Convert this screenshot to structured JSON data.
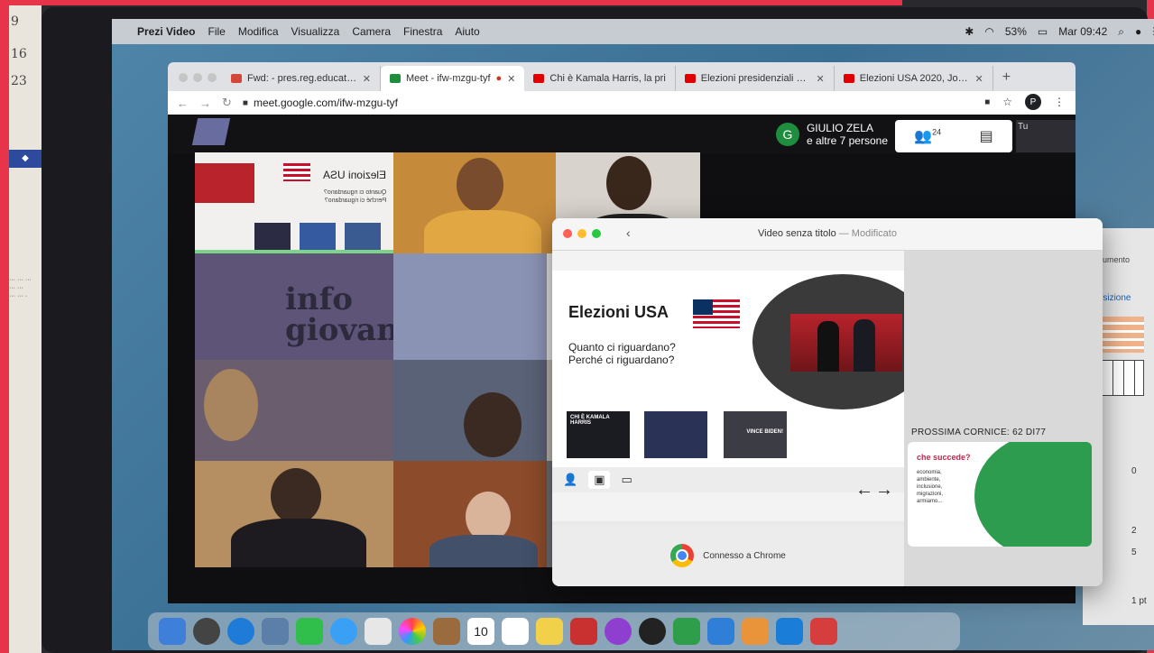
{
  "menubar": {
    "app_name": "Prezi Video",
    "items": [
      "File",
      "Modifica",
      "Visualizza",
      "Camera",
      "Finestra",
      "Aiuto"
    ],
    "battery": "53%",
    "clock": "Mar 09:42"
  },
  "browser": {
    "tabs": [
      {
        "title": "Fwd: - pres.reg.educatori",
        "color": "#d44638"
      },
      {
        "title": "Meet - ifw-mzgu-tyf",
        "color": "#1e8e3e"
      },
      {
        "title": "Chi è Kamala Harris, la pri",
        "color": "#e00000"
      },
      {
        "title": "Elezioni presidenziali Usa",
        "color": "#e00000"
      },
      {
        "title": "Elezioni USA 2020, Joe B",
        "color": "#e00000"
      }
    ],
    "new_tab_label": "+",
    "url": "meet.google.com/ifw-mzgu-tyf",
    "profile_initial": "P"
  },
  "meet": {
    "presenter_initial": "G",
    "presenter_name": "GIULIO ZELA",
    "presenter_others": "e altre 7 persone",
    "participants_count": "24",
    "self_label": "Tu"
  },
  "shared_slide": {
    "title": "Elezioni USA",
    "subtitle_1": "Quanto ci riguardano?",
    "subtitle_2": "Perché ci riguardano?"
  },
  "grid_overlay_text": "info giovani",
  "prezi": {
    "doc_title": "Video senza titolo",
    "doc_status": "— Modificato",
    "slide_title": "Elezioni USA",
    "slide_line_1": "Quanto ci riguardano?",
    "slide_line_2": "Perché ci riguardano?",
    "thumb_1": "CHI È KAMALA HARRIS",
    "thumb_3": "VINCE BIDEN!",
    "arrows": "←→",
    "next_frame_label": "PROSSIMA CORNICE: 62 DI77",
    "next_title": "che succede?",
    "next_items": [
      "economia,",
      "ambiente,",
      "inclusione,",
      "migrazioni,",
      "armiamo..."
    ],
    "status_text": "Connesso a Chrome"
  },
  "doc_panel": {
    "label": "Documento",
    "tab": "isposizione",
    "val_1": "0",
    "val_2": "2",
    "val_3": "5",
    "val_4": "1 pt"
  },
  "calendar": {
    "num_1": "9",
    "num_2": "16",
    "num_3": "23"
  },
  "dock": {
    "cal_day": "10"
  }
}
